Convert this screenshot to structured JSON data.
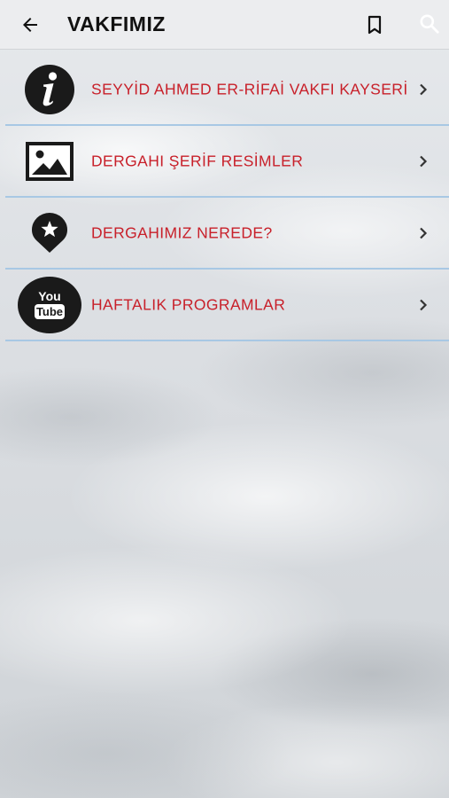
{
  "appbar": {
    "title": "VAKFIMIZ",
    "back_icon": "arrow-left-icon",
    "bookmark_icon": "bookmark-icon",
    "search_icon": "search-icon"
  },
  "menu": {
    "items": [
      {
        "label": "SEYYİD AHMED ER-RİFAİ VAKFI KAYSERİ",
        "icon": "info-icon"
      },
      {
        "label": "DERGAHI ŞERİF RESİMLER",
        "icon": "image-icon"
      },
      {
        "label": "DERGAHIMIZ NEREDE?",
        "icon": "map-pin-star-icon"
      },
      {
        "label": "HAFTALIK PROGRAMLAR",
        "icon": "youtube-icon",
        "icon_text_top": "You",
        "icon_text_bottom": "Tube"
      }
    ]
  },
  "colors": {
    "label": "#c8202a",
    "divider": "#a8c8e4",
    "icon": "#1a1a1a",
    "appbar": "#ecedef"
  }
}
